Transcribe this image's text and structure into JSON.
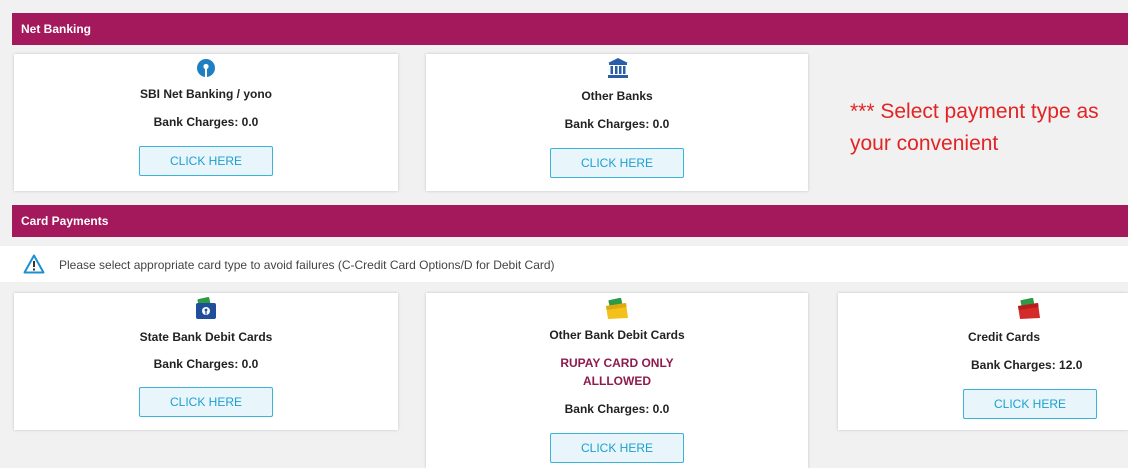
{
  "net_banking": {
    "title": "Net Banking",
    "cards": [
      {
        "title": "SBI Net Banking / yono",
        "charges": "Bank Charges: 0.0",
        "button": "CLICK HERE",
        "icon": "sbi-logo-icon"
      },
      {
        "title": "Other Banks",
        "charges": "Bank Charges: 0.0",
        "button": "CLICK HERE",
        "icon": "bank-building-icon"
      }
    ],
    "instruction": "*** Select payment type as your convenient"
  },
  "card_payments": {
    "title": "Card Payments",
    "notice": "Please select appropriate card type to avoid failures (C-Credit Card Options/D for Debit Card)",
    "notice_icon": "warning-triangle-icon",
    "cards": [
      {
        "title": "State Bank Debit Cards",
        "charges": "Bank Charges: 0.0",
        "button": "CLICK HERE",
        "icon": "sbi-card-wallet-icon"
      },
      {
        "title": "Other Bank Debit Cards",
        "note": "RUPAY CARD ONLY ALLLOWED",
        "charges": "Bank Charges: 0.0",
        "button": "CLICK HERE",
        "icon": "yellow-card-wallet-icon"
      },
      {
        "title": "Credit Cards",
        "charges": "Bank Charges: 12.0",
        "button": "CLICK HERE",
        "icon": "red-card-wallet-icon"
      }
    ]
  },
  "colors": {
    "header_bar": "#a4185c",
    "button_border": "#3bb3d8",
    "button_text": "#1c9fd0",
    "instruction_text": "#e22424",
    "note_text": "#8e1b4f"
  }
}
